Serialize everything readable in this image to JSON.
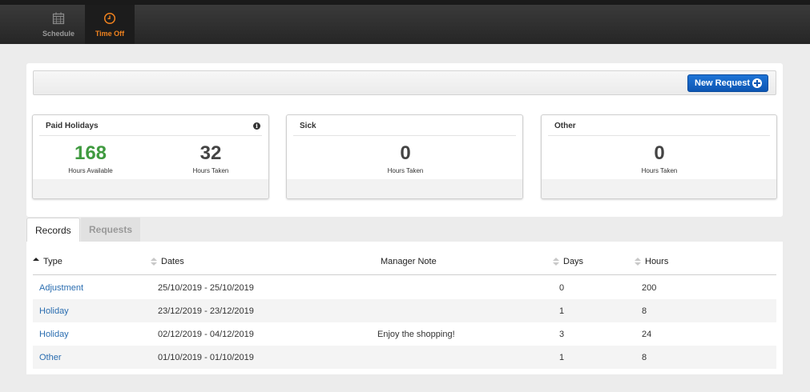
{
  "nav": {
    "items": [
      {
        "label": "Schedule",
        "icon": "calendar-icon",
        "active": false
      },
      {
        "label": "Time Off",
        "icon": "clock-icon",
        "active": true
      }
    ]
  },
  "toolbar": {
    "new_request_label": "New Request"
  },
  "stats": {
    "paid": {
      "title": "Paid Holidays",
      "available": "168",
      "available_label": "Hours Available",
      "taken": "32",
      "taken_label": "Hours Taken"
    },
    "sick": {
      "title": "Sick",
      "taken": "0",
      "taken_label": "Hours Taken"
    },
    "other": {
      "title": "Other",
      "taken": "0",
      "taken_label": "Hours Taken"
    }
  },
  "tabs": [
    {
      "label": "Records",
      "active": true
    },
    {
      "label": "Requests",
      "active": false
    }
  ],
  "table": {
    "headers": {
      "type": "Type",
      "dates": "Dates",
      "note": "Manager Note",
      "days": "Days",
      "hours": "Hours"
    },
    "rows": [
      {
        "type": "Adjustment",
        "dates": "25/10/2019 - 25/10/2019",
        "note": "",
        "days": "0",
        "hours": "200"
      },
      {
        "type": "Holiday",
        "dates": "23/12/2019 - 23/12/2019",
        "note": "",
        "days": "1",
        "hours": "8"
      },
      {
        "type": "Holiday",
        "dates": "02/12/2019 - 04/12/2019",
        "note": "Enjoy the shopping!",
        "days": "3",
        "hours": "24"
      },
      {
        "type": "Other",
        "dates": "01/10/2019 - 01/10/2019",
        "note": "",
        "days": "1",
        "hours": "8"
      }
    ]
  },
  "colors": {
    "accent": "#f0821e",
    "primary": "#0d56b3",
    "available": "#3f9a3f",
    "link": "#2a6db0"
  }
}
